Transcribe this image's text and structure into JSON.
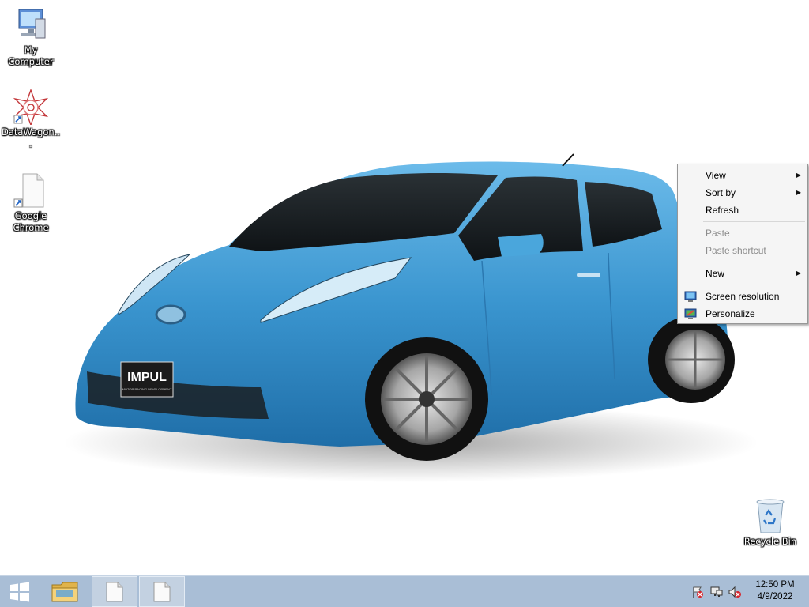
{
  "desktop": {
    "icons": [
      {
        "label": "My Computer",
        "icon": "computer-icon"
      },
      {
        "label": "DataWagon...",
        "icon": "app-shortcut-icon"
      },
      {
        "label": "Google Chrome",
        "icon": "file-shortcut-icon"
      },
      {
        "label": "Recycle Bin",
        "icon": "recycle-bin-icon"
      }
    ],
    "wallpaper": {
      "subject": "blue-hatchback-car",
      "badge_text": "IMPUL",
      "badge_subtext": "MOTOR RACING DEVELOPMENT",
      "car_color": "#3a95cf"
    }
  },
  "context_menu": {
    "items": [
      {
        "label": "View",
        "submenu": true,
        "enabled": true
      },
      {
        "label": "Sort by",
        "submenu": true,
        "enabled": true
      },
      {
        "label": "Refresh",
        "submenu": false,
        "enabled": true
      },
      {
        "label": "Paste",
        "submenu": false,
        "enabled": false
      },
      {
        "label": "Paste shortcut",
        "submenu": false,
        "enabled": false
      },
      {
        "label": "New",
        "submenu": true,
        "enabled": true
      },
      {
        "label": "Screen resolution",
        "submenu": false,
        "enabled": true,
        "icon": "display-icon"
      },
      {
        "label": "Personalize",
        "submenu": false,
        "enabled": true,
        "icon": "personalize-icon"
      }
    ]
  },
  "taskbar": {
    "start_icon": "windows-logo-icon",
    "pinned": [
      {
        "name": "File Explorer",
        "icon": "folder-icon"
      },
      {
        "name": "document-window-1",
        "icon": "document-icon"
      },
      {
        "name": "document-window-2",
        "icon": "document-icon"
      }
    ],
    "tray": {
      "icons": [
        "action-center-flag-icon",
        "network-icon",
        "volume-muted-icon"
      ],
      "time": "12:50 PM",
      "date": "4/9/2022"
    },
    "color": "#a9bed6"
  }
}
